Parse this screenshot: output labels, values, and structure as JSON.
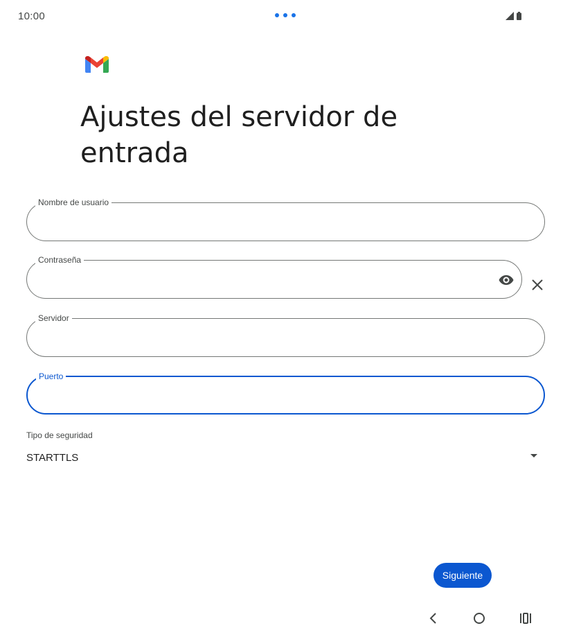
{
  "status_bar": {
    "time": "10:00"
  },
  "app": {
    "logo": "gmail-logo"
  },
  "title": "Ajustes del servidor de entrada",
  "fields": {
    "username": {
      "label": "Nombre de usuario",
      "value": ""
    },
    "password": {
      "label": "Contraseña",
      "value": ""
    },
    "server": {
      "label": "Servidor",
      "value": ""
    },
    "port": {
      "label": "Puerto",
      "value": ""
    }
  },
  "security": {
    "label": "Tipo de seguridad",
    "selected": "STARTTLS"
  },
  "buttons": {
    "next": "Siguiente"
  },
  "icons": {
    "password_visibility": "eye-icon",
    "clear": "close-icon",
    "dropdown": "caret-down-icon",
    "nav_back": "back-chevron-icon",
    "nav_home": "home-circle-icon",
    "nav_recents": "recents-icon"
  },
  "colors": {
    "accent": "#0b57d0",
    "outline": "#747775",
    "text": "#1f1f1f"
  }
}
